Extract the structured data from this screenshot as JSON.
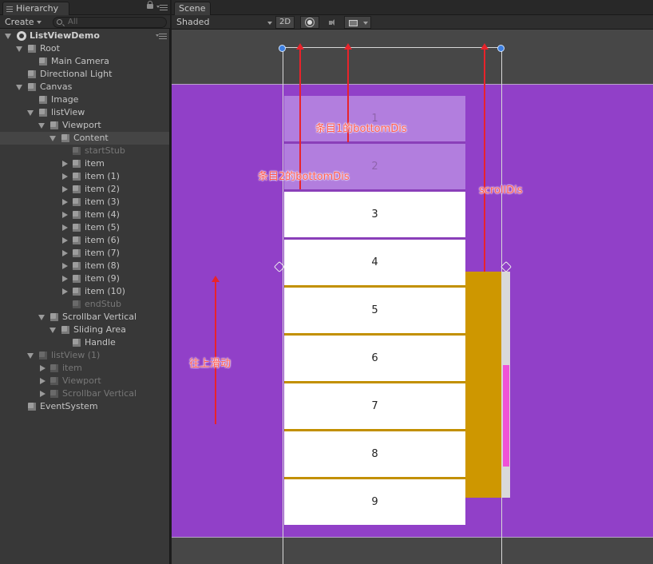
{
  "hierarchy": {
    "tab_label": "Hierarchy",
    "create_label": "Create",
    "search_placeholder": "All",
    "scene_name": "ListViewDemo",
    "rows": [
      {
        "label": "Root"
      },
      {
        "label": "Main Camera"
      },
      {
        "label": "Directional Light"
      },
      {
        "label": "Canvas"
      },
      {
        "label": "Image"
      },
      {
        "label": "listView"
      },
      {
        "label": "Viewport"
      },
      {
        "label": "Content"
      },
      {
        "label": "startStub"
      },
      {
        "label": "item"
      },
      {
        "label": "item (1)"
      },
      {
        "label": "item (2)"
      },
      {
        "label": "item (3)"
      },
      {
        "label": "item (4)"
      },
      {
        "label": "item (5)"
      },
      {
        "label": "item (6)"
      },
      {
        "label": "item (7)"
      },
      {
        "label": "item (8)"
      },
      {
        "label": "item (9)"
      },
      {
        "label": "item (10)"
      },
      {
        "label": "endStub"
      },
      {
        "label": "Scrollbar Vertical"
      },
      {
        "label": "Sliding Area"
      },
      {
        "label": "Handle"
      },
      {
        "label": "listView (1)"
      },
      {
        "label": "item"
      },
      {
        "label": "Viewport"
      },
      {
        "label": "Scrollbar Vertical"
      },
      {
        "label": "EventSystem"
      }
    ]
  },
  "scene": {
    "tab_label": "Scene",
    "shading_mode": "Shaded",
    "mode_2d_label": "2D",
    "canvas_color": "#9140c8",
    "items": [
      "1",
      "2",
      "3",
      "4",
      "5",
      "6",
      "7",
      "8",
      "9"
    ],
    "annotations": {
      "item1_bottom": "条目1的bottomDis",
      "item2_bottom": "条目2的bottomDis",
      "scroll_dis": "scrollDis",
      "scroll_up": "往上滑动"
    }
  }
}
